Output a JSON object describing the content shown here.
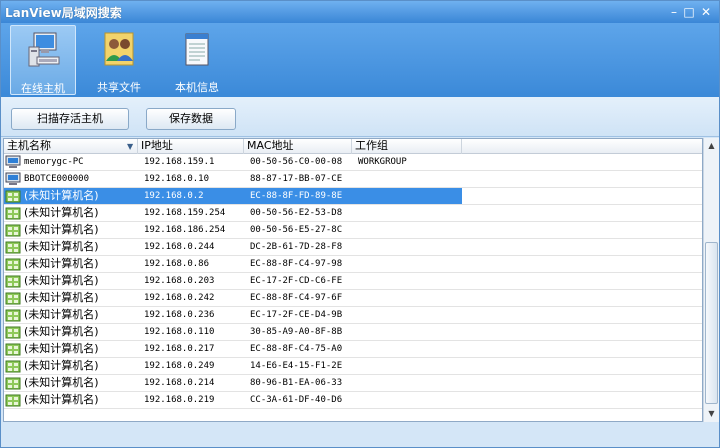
{
  "window": {
    "title": "LanView局域网搜索"
  },
  "toolbar": {
    "items": [
      {
        "label": "在线主机",
        "icon": "computer-icon",
        "active": true
      },
      {
        "label": "共享文件",
        "icon": "shared-users-icon",
        "active": false
      },
      {
        "label": "本机信息",
        "icon": "notepad-icon",
        "active": false
      }
    ]
  },
  "buttons": {
    "scan": "扫描存活主机",
    "save": "保存数据"
  },
  "table": {
    "headers": [
      "主机名称",
      "IP地址",
      "MAC地址",
      "工作组"
    ],
    "rows": [
      {
        "name": "memorygc-PC",
        "ip": "192.168.159.1",
        "mac": "00-50-56-C0-00-08",
        "group": "WORKGROUP",
        "icon": "computer",
        "selected": false
      },
      {
        "name": "BBOTCE000000",
        "ip": "192.168.0.10",
        "mac": "88-87-17-BB-07-CE",
        "group": "",
        "icon": "computer",
        "selected": false
      },
      {
        "name": "(未知计算机名)",
        "ip": "192.168.0.2",
        "mac": "EC-88-8F-FD-89-8E",
        "group": "",
        "icon": "network",
        "selected": true
      },
      {
        "name": "(未知计算机名)",
        "ip": "192.168.159.254",
        "mac": "00-50-56-E2-53-D8",
        "group": "",
        "icon": "network",
        "selected": false
      },
      {
        "name": "(未知计算机名)",
        "ip": "192.168.186.254",
        "mac": "00-50-56-E5-27-8C",
        "group": "",
        "icon": "network",
        "selected": false
      },
      {
        "name": "(未知计算机名)",
        "ip": "192.168.0.244",
        "mac": "DC-2B-61-7D-28-F8",
        "group": "",
        "icon": "network",
        "selected": false
      },
      {
        "name": "(未知计算机名)",
        "ip": "192.168.0.86",
        "mac": "EC-88-8F-C4-97-98",
        "group": "",
        "icon": "network",
        "selected": false
      },
      {
        "name": "(未知计算机名)",
        "ip": "192.168.0.203",
        "mac": "EC-17-2F-CD-C6-FE",
        "group": "",
        "icon": "network",
        "selected": false
      },
      {
        "name": "(未知计算机名)",
        "ip": "192.168.0.242",
        "mac": "EC-88-8F-C4-97-6F",
        "group": "",
        "icon": "network",
        "selected": false
      },
      {
        "name": "(未知计算机名)",
        "ip": "192.168.0.236",
        "mac": "EC-17-2F-CE-D4-9B",
        "group": "",
        "icon": "network",
        "selected": false
      },
      {
        "name": "(未知计算机名)",
        "ip": "192.168.0.110",
        "mac": "30-85-A9-A0-8F-8B",
        "group": "",
        "icon": "network",
        "selected": false
      },
      {
        "name": "(未知计算机名)",
        "ip": "192.168.0.217",
        "mac": "EC-88-8F-C4-75-A0",
        "group": "",
        "icon": "network",
        "selected": false
      },
      {
        "name": "(未知计算机名)",
        "ip": "192.168.0.249",
        "mac": "14-E6-E4-15-F1-2E",
        "group": "",
        "icon": "network",
        "selected": false
      },
      {
        "name": "(未知计算机名)",
        "ip": "192.168.0.214",
        "mac": "80-96-B1-EA-06-33",
        "group": "",
        "icon": "network",
        "selected": false
      },
      {
        "name": "(未知计算机名)",
        "ip": "192.168.0.219",
        "mac": "CC-3A-61-DF-40-D6",
        "group": "",
        "icon": "network",
        "selected": false
      }
    ]
  },
  "colors": {
    "titlebar": "#3a86d6",
    "selection": "#3a8ee6"
  }
}
